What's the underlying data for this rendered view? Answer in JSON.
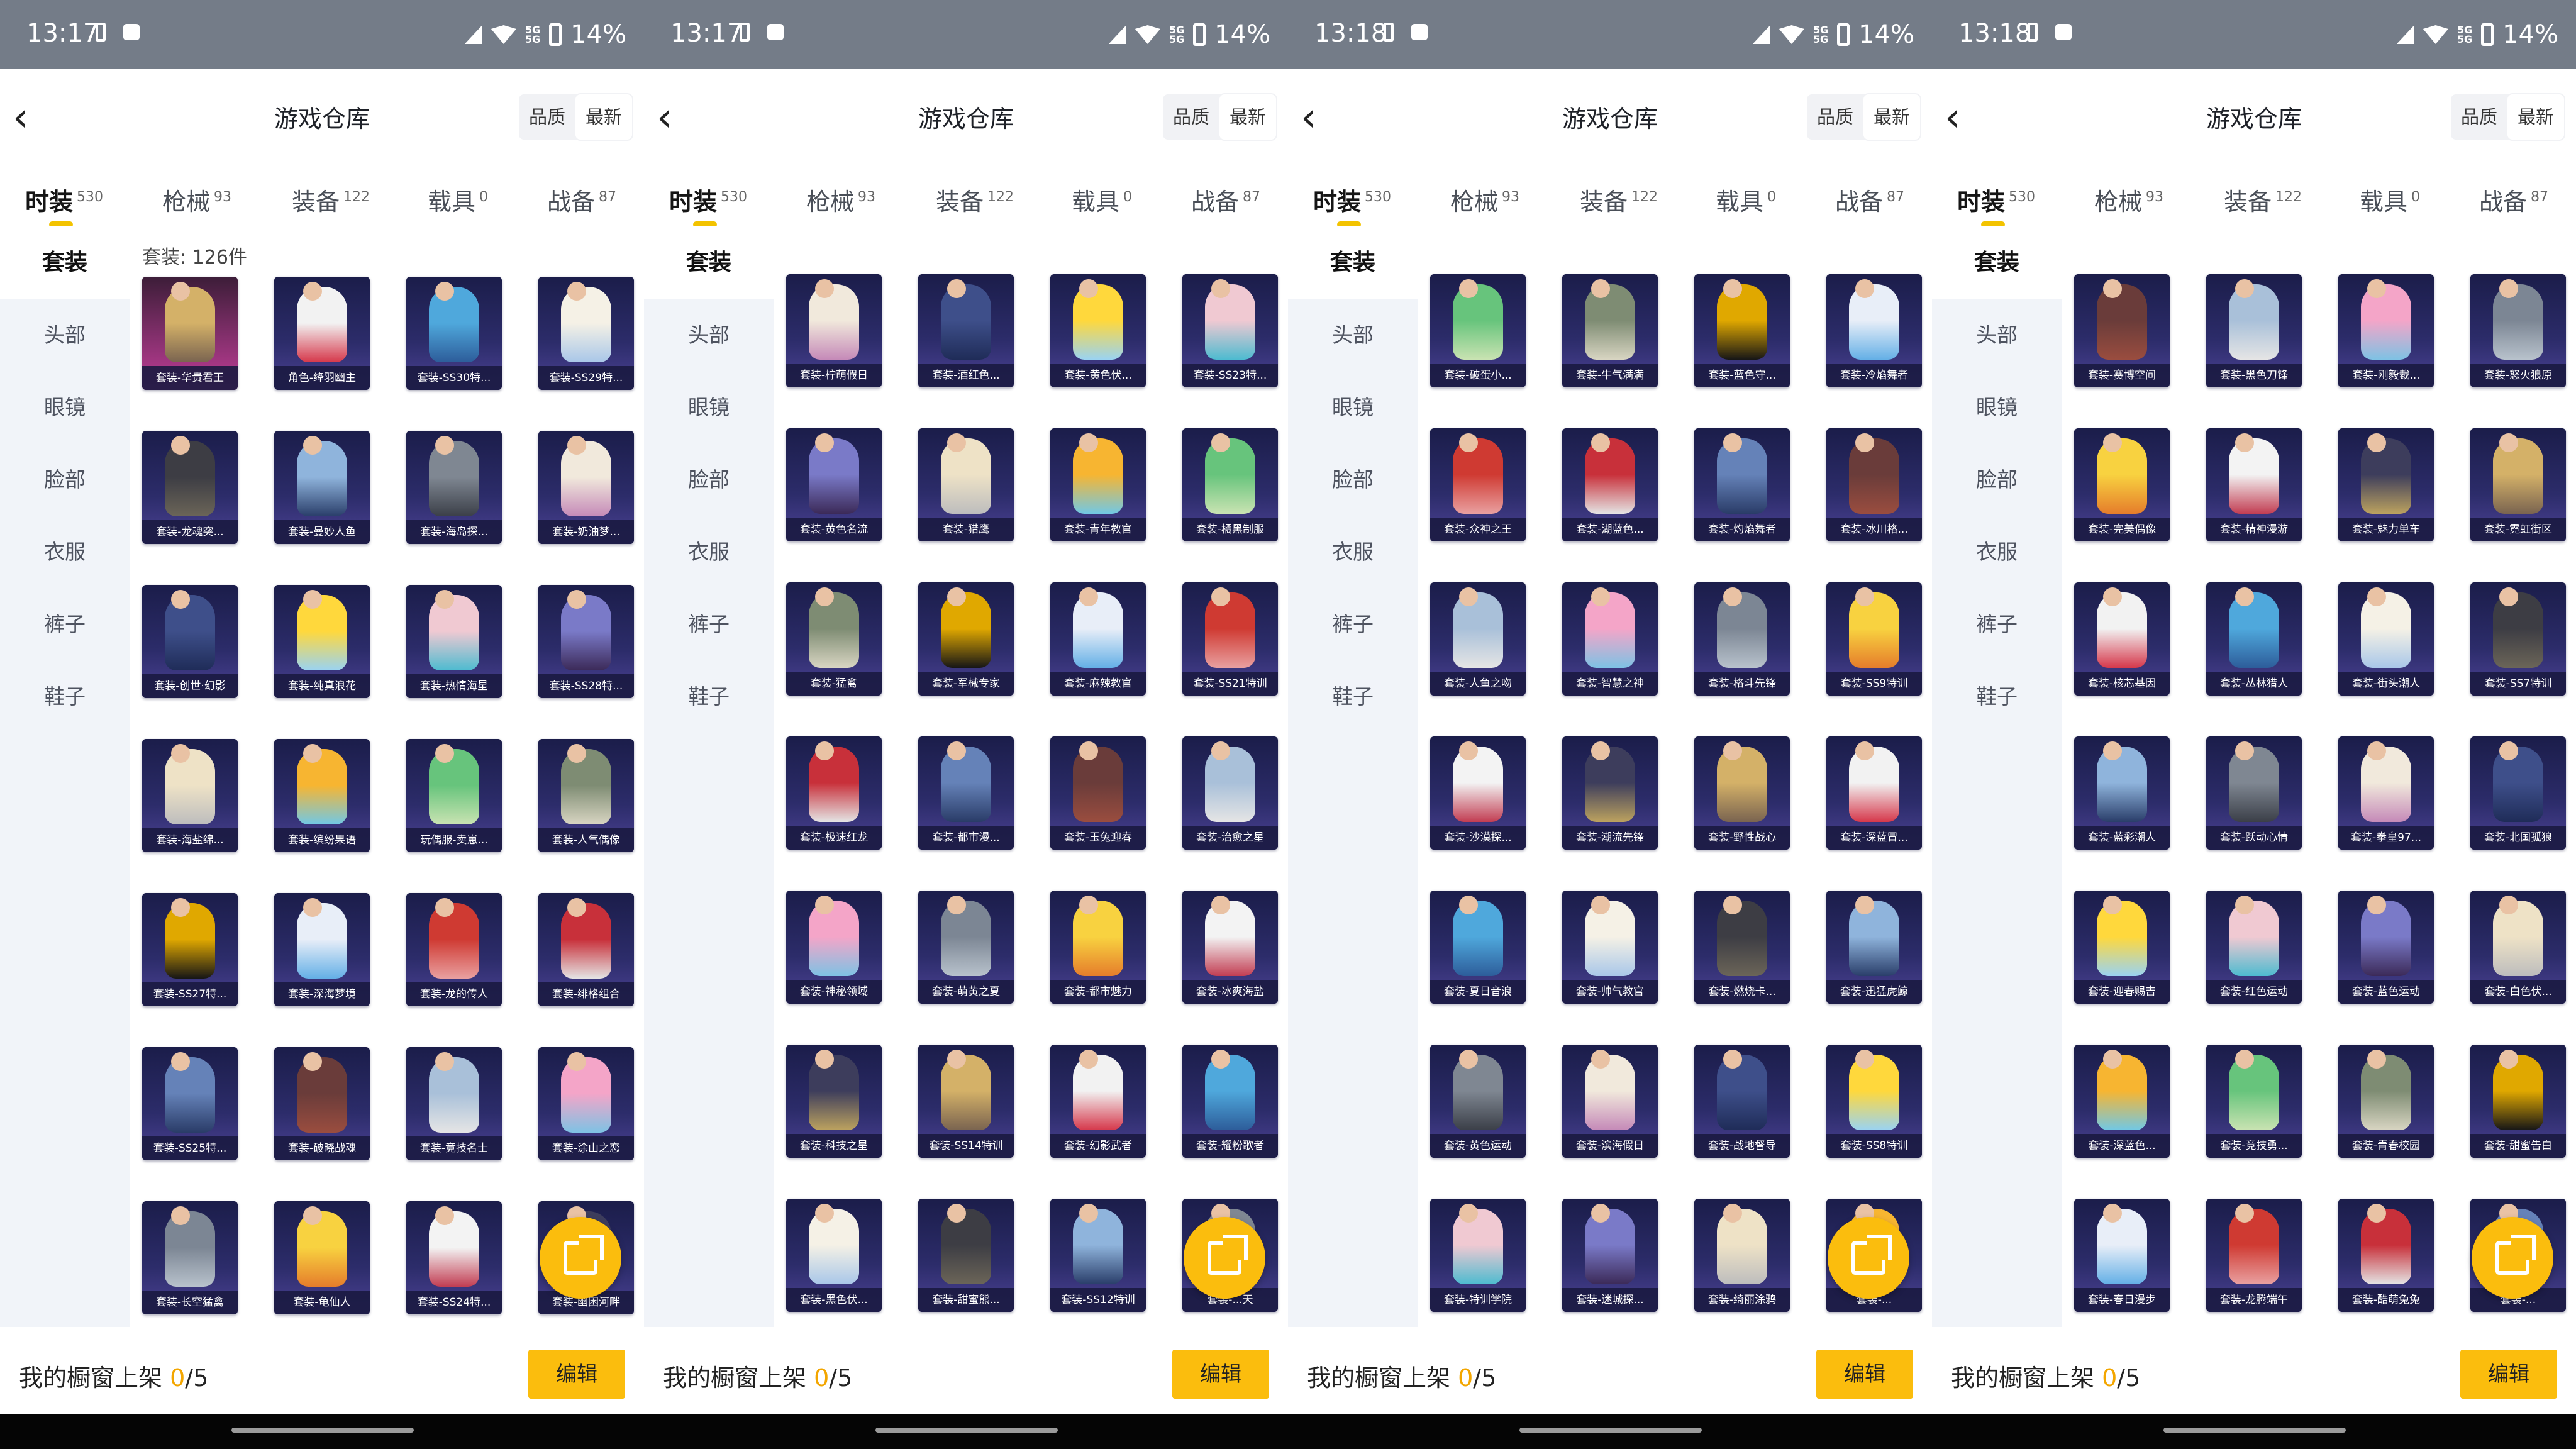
{
  "status_bar": {
    "battery": "14%",
    "network": "5G"
  },
  "icons": {
    "back": "chevron-left-icon",
    "share": "external-link-icon",
    "wifi": "wifi-icon",
    "battery": "battery-icon"
  },
  "sort_options": [
    "品质",
    "最新"
  ],
  "tabs": [
    {
      "label": "时装",
      "count": "530"
    },
    {
      "label": "枪械",
      "count": "93"
    },
    {
      "label": "装备",
      "count": "122"
    },
    {
      "label": "载具",
      "count": "0"
    },
    {
      "label": "战备",
      "count": "87"
    }
  ],
  "side_categories": [
    "套装",
    "头部",
    "眼镜",
    "脸部",
    "衣服",
    "裤子",
    "鞋子"
  ],
  "bottom_bar": {
    "label": "我的橱窗上架",
    "shelved": "0",
    "capacity": "/5",
    "edit_label": "编辑"
  },
  "colors": {
    "accent": "#FBBD0D",
    "statusbar": "#747C88",
    "sidebar": "#F1F4F9"
  },
  "screens": [
    {
      "time": "13:17",
      "title": "游戏仓库",
      "grid_label": "套装: 126件",
      "items": [
        "套装-华贵君王",
        "角色-绛羽幽主",
        "套装-SS30特...",
        "套装-SS29特...",
        "套装-龙魂突...",
        "套装-曼妙人鱼",
        "套装-海岛探...",
        "套装-奶油梦...",
        "套装-创世·幻影",
        "套装-纯真浪花",
        "套装-热情海星",
        "套装-SS28特...",
        "套装-海盐绵...",
        "套装-缤纷果语",
        "玩偶服-卖崽...",
        "套装-人气偶像",
        "套装-SS27特...",
        "套装-深海梦境",
        "套装-龙的传人",
        "套装-绯格组合",
        "套装-SS25特...",
        "套装-破晓战魂",
        "套装-竞技名士",
        "套装-涂山之恋",
        "套装-长空猛禽",
        "套装-龟仙人",
        "套装-SS24特...",
        "套装-幽困河畔"
      ]
    },
    {
      "time": "13:17",
      "title": "游戏仓库",
      "grid_label": "",
      "items": [
        "套装-柠萌假日",
        "套装-酒红色...",
        "套装-黄色伏...",
        "套装-SS23特...",
        "套装-黄色名流",
        "套装-猎鹰",
        "套装-青年教官",
        "套装-橘黑制服",
        "套装-猛禽",
        "套装-军械专家",
        "套装-麻辣教官",
        "套装-SS21特训",
        "套装-极速红龙",
        "套装-都市漫...",
        "套装-玉兔迎春",
        "套装-治愈之星",
        "套装-神秘领域",
        "套装-萌黄之夏",
        "套装-都市魅力",
        "套装-冰爽海盐",
        "套装-科技之星",
        "套装-SS14特训",
        "套装-幻影武者",
        "套装-耀粉歌者",
        "套装-黑色伏...",
        "套装-甜蜜熊...",
        "套装-SS12特训",
        "套装-...天"
      ]
    },
    {
      "time": "13:18",
      "title": "游戏仓库",
      "grid_label": "",
      "items": [
        "套装-破蛋小...",
        "套装-牛气满满",
        "套装-蓝色守...",
        "套装-冷焰舞者",
        "套装-众神之王",
        "套装-湖蓝色...",
        "套装-灼焰舞者",
        "套装-冰川格...",
        "套装-人鱼之吻",
        "套装-智慧之神",
        "套装-格斗先锋",
        "套装-SS9特训",
        "套装-沙漠探...",
        "套装-潮流先锋",
        "套装-野性战心",
        "套装-深蓝冒...",
        "套装-夏日音浪",
        "套装-帅气教官",
        "套装-燃烧卡...",
        "套装-迅猛虎鲸",
        "套装-黄色运动",
        "套装-滨海假日",
        "套装-战地督导",
        "套装-SS8特训",
        "套装-特训学院",
        "套装-迷城探...",
        "套装-绮丽涂鸦",
        "套装-..."
      ]
    },
    {
      "time": "13:18",
      "title": "游戏仓库",
      "grid_label": "",
      "items": [
        "套装-赛博空间",
        "套装-黑色刀锋",
        "套装-刚毅裁...",
        "套装-怒火狼原",
        "套装-完美偶像",
        "套装-精神漫游",
        "套装-魅力单车",
        "套装-霓虹街区",
        "套装-核芯基因",
        "套装-丛林猎人",
        "套装-街头潮人",
        "套装-SS7特训",
        "套装-蓝彩潮人",
        "套装-跃动心情",
        "套装-拳皇97...",
        "套装-北国孤狼",
        "套装-迎春赐吉",
        "套装-红色运动",
        "套装-蓝色运动",
        "套装-白色伏...",
        "套装-深蓝色...",
        "套装-竞技勇...",
        "套装-青春校园",
        "套装-甜蜜告白",
        "套装-春日漫步",
        "套装-龙腾端午",
        "套装-酷萌兔兔",
        "套装-..."
      ]
    }
  ]
}
